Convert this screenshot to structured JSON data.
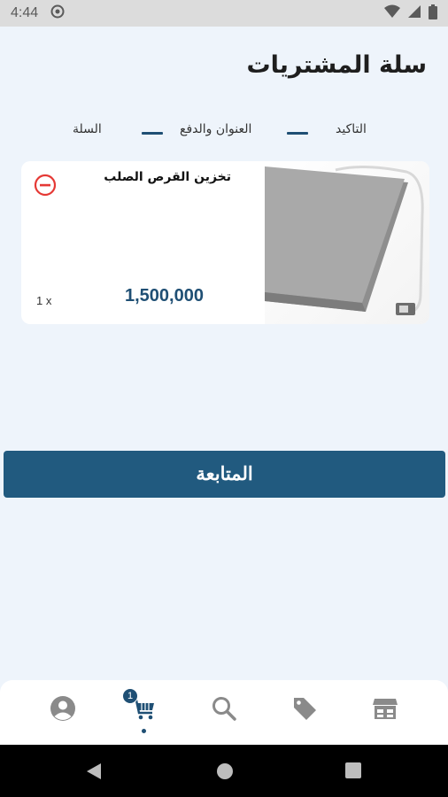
{
  "status_bar": {
    "time": "4:44"
  },
  "page": {
    "title": "سلة المشتريات"
  },
  "stepper": {
    "steps": [
      {
        "label": "التاكيد"
      },
      {
        "label": "العنوان والدفع"
      },
      {
        "label": "السلة"
      }
    ]
  },
  "cart": {
    "items": [
      {
        "name": "تخزين القرص الصلب",
        "price": "1,500,000",
        "quantity": "1 x"
      }
    ]
  },
  "actions": {
    "continue_label": "المتابعة"
  },
  "bottom_nav": {
    "cart_badge": "1",
    "items": [
      {
        "icon": "user-icon"
      },
      {
        "icon": "cart-icon"
      },
      {
        "icon": "search-icon"
      },
      {
        "icon": "tag-icon"
      },
      {
        "icon": "store-icon"
      }
    ]
  },
  "colors": {
    "primary": "#215a7f",
    "accent_dark": "#1f4f74",
    "background": "#eef4fb",
    "remove_red": "#e53935"
  }
}
